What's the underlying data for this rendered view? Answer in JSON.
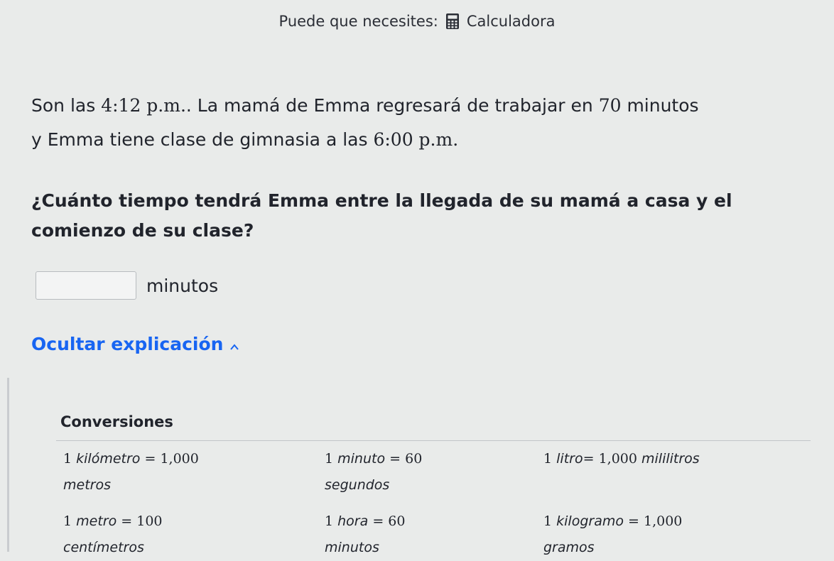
{
  "tools": {
    "prefix": "Puede que necesites:",
    "calculator_label": "Calculadora",
    "calculator_icon": "calculator-icon"
  },
  "problem": {
    "line1_a": "Son las ",
    "time_now": "4:12",
    "pm1": " p.m.",
    "line1_b": ". La mamá de Emma regresará de trabajar en ",
    "minutes_value": "70",
    "line1_c": " minutos",
    "line2_a": "y Emma tiene clase de gimnasia a las ",
    "time_class": "6:00",
    "pm2": " p.m.",
    "question": "¿Cuánto tiempo tendrá Emma entre la llegada de su mamá a casa y el comienzo de su clase?"
  },
  "answer": {
    "value": "",
    "placeholder": "",
    "unit": "minutos"
  },
  "explanation": {
    "toggle_label": "Ocultar explicación",
    "toggle_icon": "chevron-up-icon",
    "conversions_title": "Conversiones",
    "conversions": [
      {
        "amount": "1",
        "unit": "kilómetro",
        "eq": "1,000",
        "unit2": "metros"
      },
      {
        "amount": "1",
        "unit": "minuto",
        "eq": "60",
        "unit2": "segundos"
      },
      {
        "amount": "1",
        "unit": "litro",
        "eq": "1,000",
        "unit2": "mililitros"
      },
      {
        "amount": "1",
        "unit": "metro",
        "eq": "100",
        "unit2": "centímetros"
      },
      {
        "amount": "1",
        "unit": "hora",
        "eq": "60",
        "unit2": "minutos"
      },
      {
        "amount": "1",
        "unit": "kilogramo",
        "eq": "1,000",
        "unit2": "gramos"
      }
    ]
  },
  "colors": {
    "background": "#e9ebea",
    "text": "#21242c",
    "link": "#1865f2",
    "border": "#c9cccf"
  }
}
